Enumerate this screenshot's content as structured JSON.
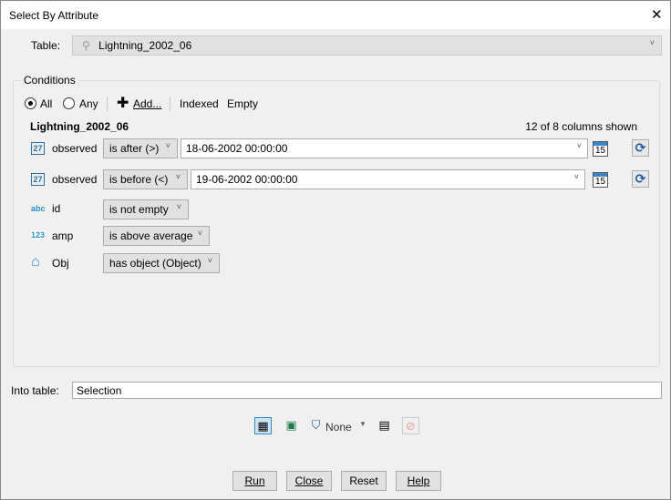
{
  "window": {
    "title": "Select By Attribute",
    "close": "✕"
  },
  "table": {
    "label": "Table:",
    "value": "Lightning_2002_06"
  },
  "conditions": {
    "group_label": "Conditions",
    "all_label": "All",
    "any_label": "Any",
    "match": "All",
    "add_label": "Add...",
    "indexed_label": "Indexed",
    "empty_label": "Empty",
    "table_name": "Lightning_2002_06",
    "columns_shown": "12 of 8 columns shown",
    "rows": [
      {
        "icon": "calendar-icon",
        "icon_text": "27",
        "field": "observed",
        "operator": "is after (>)",
        "value": "18-06-2002 00:00:00"
      },
      {
        "icon": "calendar-icon",
        "icon_text": "27",
        "field": "observed",
        "operator": "is before (<)",
        "value": "19-06-2002 00:00:00"
      },
      {
        "icon": "text-field-icon",
        "icon_text": "abc",
        "field": "id",
        "operator": "is not empty"
      },
      {
        "icon": "number-field-icon",
        "icon_text": "123",
        "field": "amp",
        "operator": "is above average"
      },
      {
        "icon": "object-field-icon",
        "icon_text": "⌂",
        "field": "Obj",
        "operator": "has object (Object)"
      }
    ],
    "cal_day": "15"
  },
  "into": {
    "label": "Into table:",
    "value": "Selection"
  },
  "toolbar": {
    "style_label": "None"
  },
  "buttons": {
    "run": "Run",
    "close": "Close",
    "reset": "Reset",
    "help": "Help"
  }
}
